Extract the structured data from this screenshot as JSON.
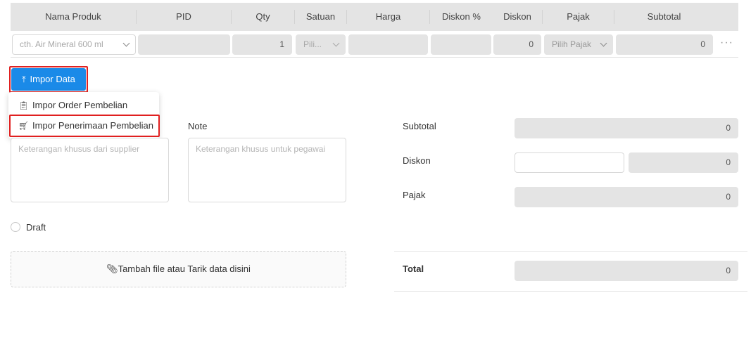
{
  "table": {
    "headers": [
      "Nama Produk",
      "PID",
      "Qty",
      "Satuan",
      "Harga",
      "Diskon %",
      "Diskon",
      "Pajak",
      "Subtotal"
    ],
    "row": {
      "product_placeholder": "cth. Air Mineral 600 ml",
      "qty": "1",
      "satuan_placeholder": "Pili...",
      "diskon": "0",
      "pajak_placeholder": "Pilih Pajak",
      "subtotal": "0",
      "more": "···"
    }
  },
  "import": {
    "button_label": "Impor Data",
    "menu": [
      "Impor Order Pembelian",
      "Impor Penerimaan Pembelian"
    ]
  },
  "notes": {
    "supplier_placeholder": "Keterangan khusus dari supplier",
    "note_label": "Note",
    "note_placeholder": "Keterangan khusus untuk pegawai"
  },
  "draft_label": "Draft",
  "attach_label": "Tambah file atau Tarik data disini",
  "summary": {
    "subtotal_label": "Subtotal",
    "subtotal_value": "0",
    "diskon_label": "Diskon",
    "diskon_value": "0",
    "pajak_label": "Pajak",
    "pajak_value": "0",
    "total_label": "Total",
    "total_value": "0"
  },
  "colors": {
    "primary": "#1a8ae8",
    "highlight": "#e02020"
  }
}
